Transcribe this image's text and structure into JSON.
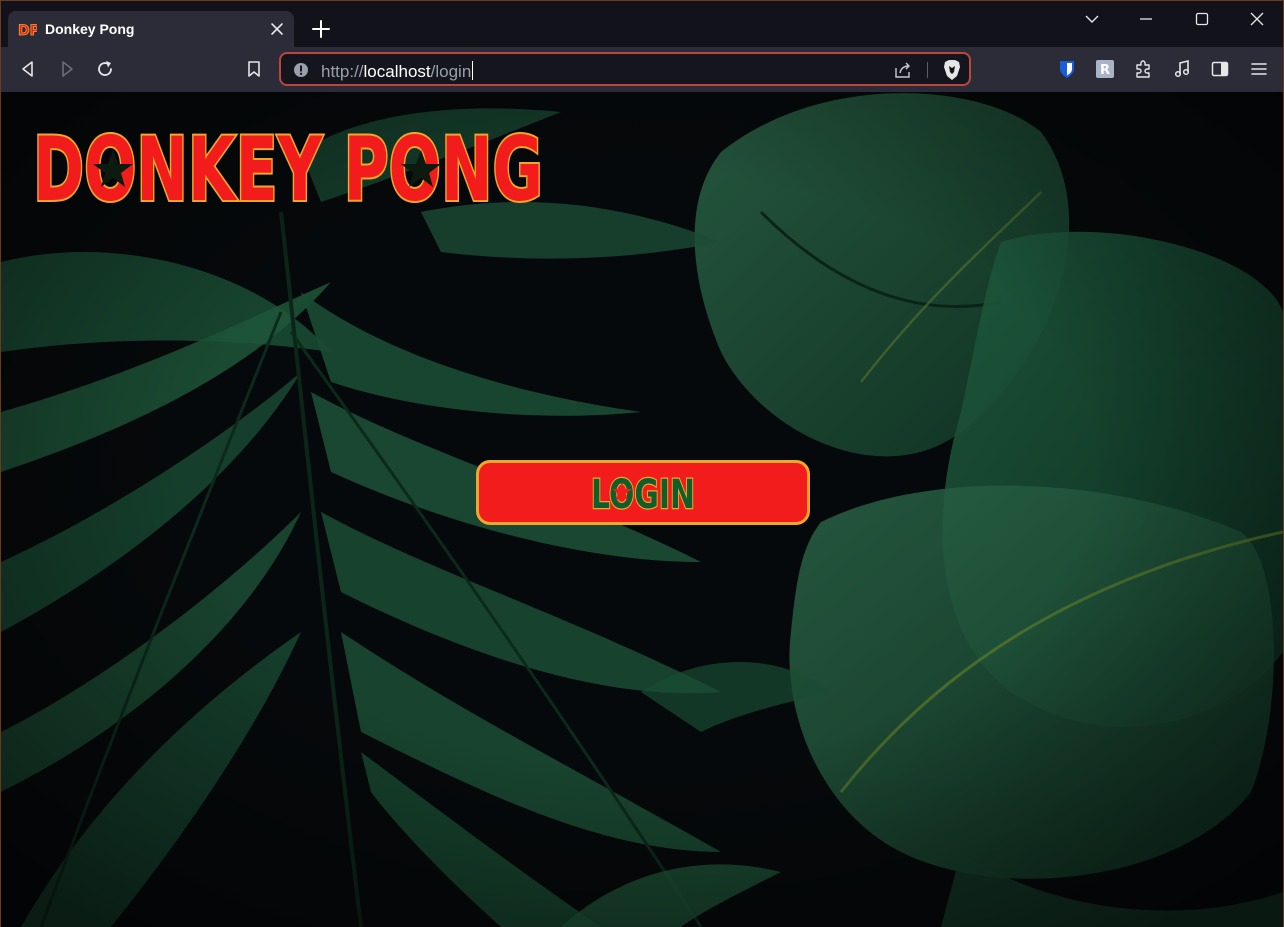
{
  "browser": {
    "tab": {
      "title": "Donkey Pong",
      "favicon_text": "DP"
    },
    "url": {
      "scheme": "http://",
      "host": "localhost",
      "path": "/login"
    },
    "colors": {
      "frame": "#12131a",
      "toolbar": "#2b2c38",
      "omnibox_border": "#b9463f"
    }
  },
  "page": {
    "logo": {
      "text": "DONKEY PONG",
      "fill": "#f21c1c",
      "outline": "#f0a82a"
    },
    "login": {
      "label": "LOGIN",
      "fill": "#f21c1c",
      "border": "#f0a82a",
      "text_color": "#0f5e2c"
    }
  }
}
